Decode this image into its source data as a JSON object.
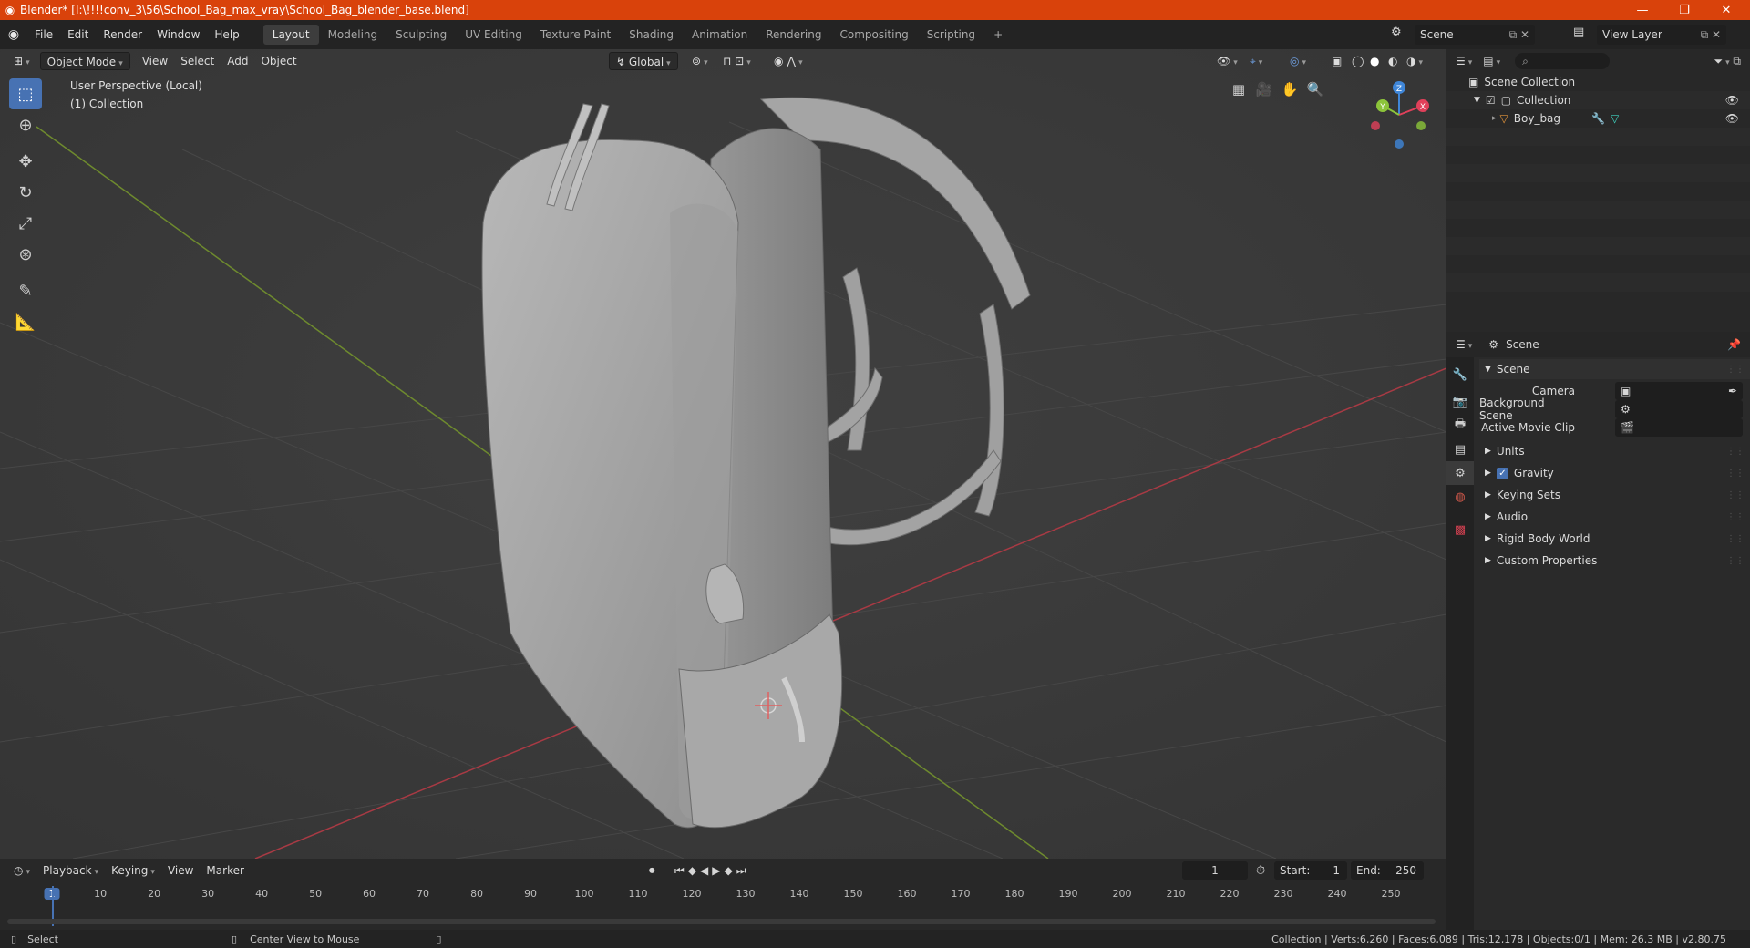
{
  "window": {
    "title": "Blender* [I:\\!!!!conv_3\\56\\School_Bag_max_vray\\School_Bag_blender_base.blend]",
    "minimize": "—",
    "maximize": "❐",
    "close": "✕"
  },
  "menu": [
    "File",
    "Edit",
    "Render",
    "Window",
    "Help"
  ],
  "workspaces": [
    "Layout",
    "Modeling",
    "Sculpting",
    "UV Editing",
    "Texture Paint",
    "Shading",
    "Animation",
    "Rendering",
    "Compositing",
    "Scripting"
  ],
  "workspace_add": "+",
  "scene_field": "Scene",
  "view_layer_field": "View Layer",
  "viewport": {
    "mode": "Object Mode",
    "menus": [
      "View",
      "Select",
      "Add",
      "Object"
    ],
    "orientation": "Global",
    "info_line1": "User Perspective (Local)",
    "info_line2": "(1) Collection",
    "gizmo": {
      "x": "X",
      "y": "Y",
      "z": "Z"
    }
  },
  "outliner": {
    "root": "Scene Collection",
    "collection": "Collection",
    "object": "Boy_bag"
  },
  "properties": {
    "header": "Scene",
    "panel_title": "Scene",
    "camera_label": "Camera",
    "bg_scene_label": "Background Scene",
    "movie_clip_label": "Active Movie Clip",
    "sections": [
      "Units",
      "Gravity",
      "Keying Sets",
      "Audio",
      "Rigid Body World",
      "Custom Properties"
    ]
  },
  "timeline": {
    "menus": [
      "Playback",
      "Keying",
      "View",
      "Marker"
    ],
    "current_frame": "1",
    "start_label": "Start:",
    "start": "1",
    "end_label": "End:",
    "end": "250",
    "ticks": [
      "1",
      "10",
      "20",
      "30",
      "40",
      "50",
      "60",
      "70",
      "80",
      "90",
      "100",
      "110",
      "120",
      "130",
      "140",
      "150",
      "160",
      "170",
      "180",
      "190",
      "200",
      "210",
      "220",
      "230",
      "240",
      "250"
    ]
  },
  "status": {
    "left": "Select",
    "middle": "Center View to Mouse",
    "right": "Collection | Verts:6,260 | Faces:6,089 | Tris:12,178 | Objects:0/1 | Mem: 26.3 MB | v2.80.75"
  },
  "colors": {
    "accent": "#4772b3",
    "title_bar": "#d9420b",
    "x_axis": "#e0405a",
    "y_axis": "#8cc43a",
    "z_axis": "#3f86d8"
  }
}
